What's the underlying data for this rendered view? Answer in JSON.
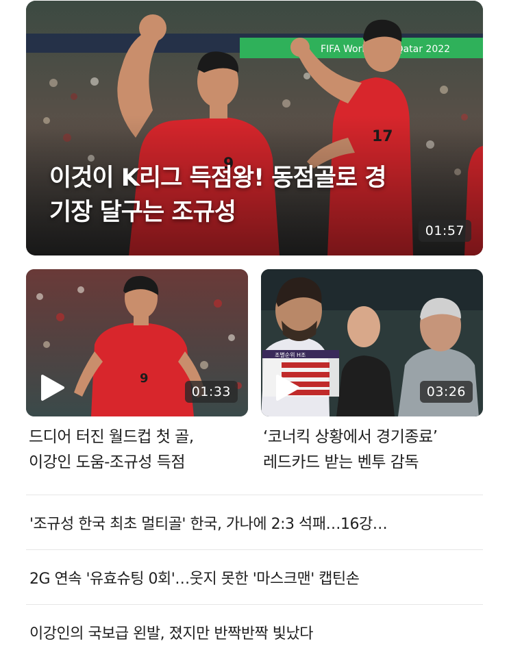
{
  "hero": {
    "title_line1": "이것이 K리그 득점왕! 동점골로 경",
    "title_line2": "기장 달구는 조규성",
    "duration": "01:57",
    "banner_text": "FIFA World Cup Qatar 2022"
  },
  "cards": [
    {
      "duration": "01:33",
      "title_line1": "드디어 터진 월드컵 첫 골,",
      "title_line2": "이강인 도움-조규성 득점",
      "play_icon": "play-icon"
    },
    {
      "duration": "03:26",
      "title_line1": "‘코너킥 상황에서 경기종료’",
      "title_line2": "레드카드 받는 벤투 감독",
      "play_icon": "play-icon",
      "scoreboard_title": "조별순위 H조"
    }
  ],
  "headlines": [
    "'조규성 한국 최초 멀티골' 한국, 가나에 2:3 석패…16강…",
    "2G 연속 '유효슈팅 0회'…웃지 못한 '마스크맨' 캡틴손",
    "이강인의 국보급 왼발, 졌지만 반짝반짝 빛났다"
  ],
  "colors": {
    "kit_red": "#d8262c",
    "text": "#1e1e1e",
    "divider": "#e6e6e6",
    "banner_green": "#2fb15a"
  }
}
